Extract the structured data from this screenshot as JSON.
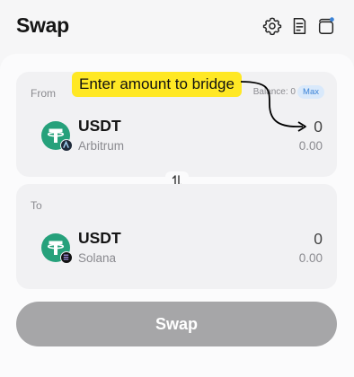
{
  "header": {
    "title": "Swap",
    "icons": [
      "gear-icon",
      "history-icon",
      "wallet-icon"
    ]
  },
  "from": {
    "label": "From",
    "balance": "Balance: 0",
    "max_label": "Max",
    "token": {
      "symbol": "USDT",
      "chain": "Arbitrum",
      "amount": "0",
      "usd_value": "0.00"
    }
  },
  "to": {
    "label": "To",
    "token": {
      "symbol": "USDT",
      "chain": "Solana",
      "amount": "0",
      "usd_value": "0.00"
    }
  },
  "swap_button": {
    "label": "Swap"
  },
  "annotation": {
    "text": "Enter amount to bridge"
  },
  "colors": {
    "accent": "#26a17b",
    "tooltip": "#ffe824",
    "button_disabled": "#a6a6a8",
    "max_pill": "#d9e9fb"
  }
}
